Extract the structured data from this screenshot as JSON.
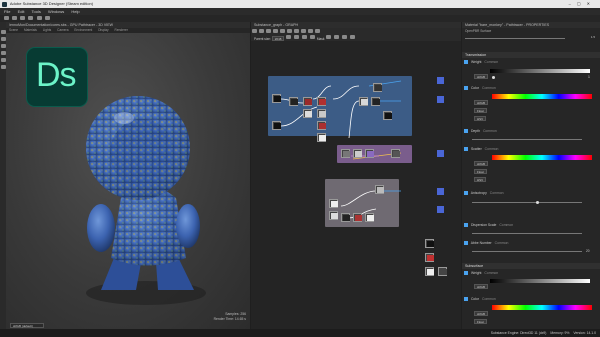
{
  "window": {
    "title": "Adobe Substance 3D Designer (Steam edition)"
  },
  "menu": [
    "File",
    "Edit",
    "Tools",
    "Windows",
    "Help"
  ],
  "viewport": {
    "title": "/ennoMon/Documentation/cores.sbs - GPU Pathtracer - 3D VIEW",
    "tabs": [
      "Scene",
      "Materials",
      "Lights",
      "Camera",
      "Environment",
      "Display",
      "Renderer"
    ],
    "logo": "Ds",
    "samples_label": "Samples: 256",
    "render_time": "Render Time: 14.65 s",
    "colorspace": "sRGB (default)"
  },
  "graph": {
    "title": "Substance_graph - GRAPH",
    "toolbar": {
      "parent_size_label": "Parent size:",
      "size_value": "2048",
      "mask_label": "Mask"
    }
  },
  "properties": {
    "title": "Material \"bare_monkey\" - Pathtracer - PROPERTIES",
    "subtitle": "OpenPBR Surface",
    "sections": {
      "transmission": "Transmission",
      "subsurface": "Subsurface"
    },
    "rows": {
      "weight": "Weight",
      "weight_badge": "Common",
      "weight_value": "1",
      "color": "Color",
      "color_badge": "Common",
      "srgb": "sRGB",
      "float": "Float",
      "hsv": "HSV",
      "depth": "Depth",
      "depth_badge": "Common",
      "scatter": "Scatter",
      "scatter_badge": "Common",
      "anisotropy": "Anisotropy",
      "anisotropy_badge": "Common",
      "dispersion": "Dispersion Scale",
      "dispersion_badge": "Common",
      "abbe": "Abbe Number",
      "abbe_badge": "Common",
      "abbe_value": "20",
      "sub_weight": "Weight",
      "sub_weight_badge": "Common",
      "sub_color": "Color",
      "sub_color_badge": "Common"
    }
  },
  "status": {
    "engine": "Substance Engine: Direct3D 11 (dx9)",
    "memory": "Memory: 9%",
    "version": "Version: 14.1.0"
  },
  "colors": {
    "accent": "#4aa3f0",
    "frame_blue": "#3c5c86",
    "frame_purple": "#7a5d8c",
    "frame_gray": "#6f6a72"
  }
}
